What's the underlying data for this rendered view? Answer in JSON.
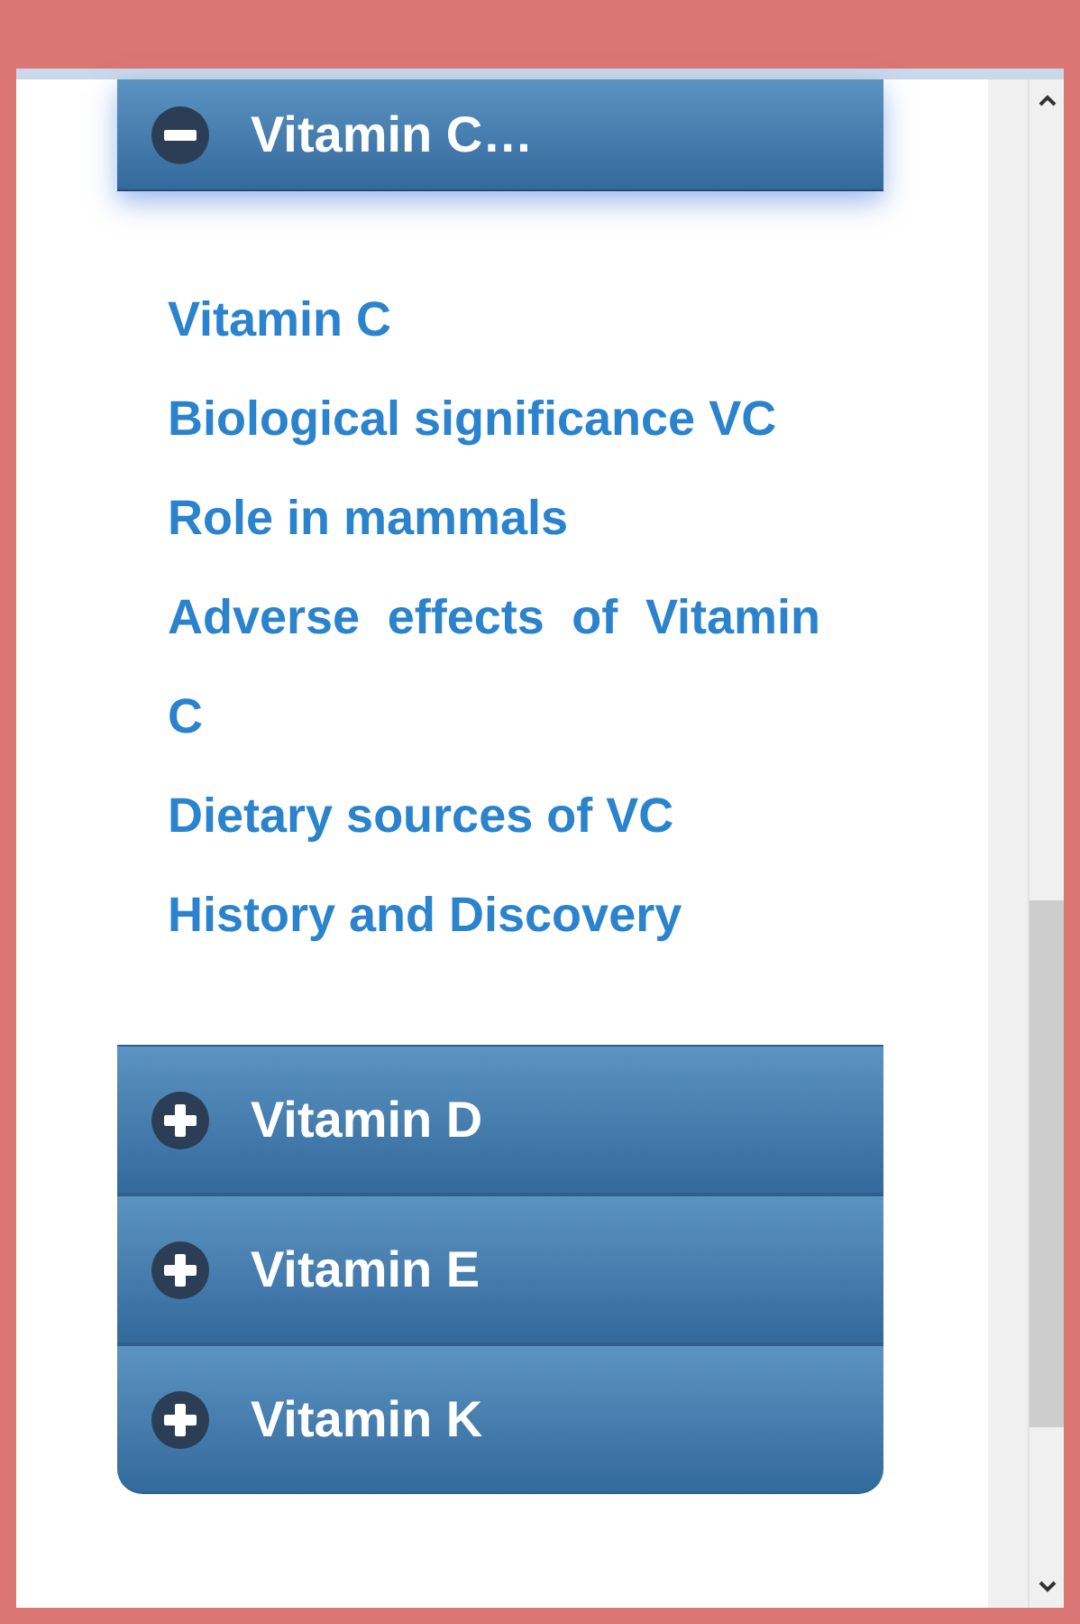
{
  "sections": [
    {
      "title": "Vitamin C…",
      "expanded": true,
      "links": [
        "Vitamin C",
        "Biological significance VC",
        "Role in mammals",
        "Adverse effects of Vitamin C",
        "Dietary sources of VC",
        "History and Discovery"
      ]
    },
    {
      "title": "Vitamin D",
      "expanded": false
    },
    {
      "title": "Vitamin E",
      "expanded": false
    },
    {
      "title": "Vitamin K",
      "expanded": false
    }
  ]
}
